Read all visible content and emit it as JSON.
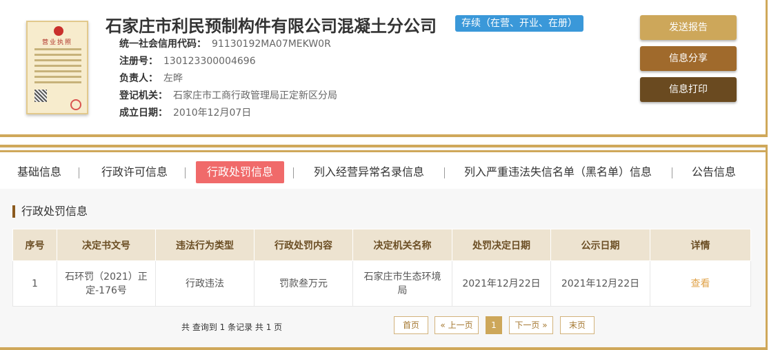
{
  "company": {
    "name": "石家庄市利民预制构件有限公司混凝土分公司",
    "status": "存续（在营、开业、在册）",
    "license_title": "营业执照"
  },
  "info": {
    "credit_code_label": "统一社会信用代码：",
    "credit_code": "91130192MA07MEKW0R",
    "reg_no_label": "注册号：",
    "reg_no": "130123300004696",
    "principal_label": "负责人：",
    "principal": "左晔",
    "authority_label": "登记机关：",
    "authority": "石家庄市工商行政管理局正定新区分局",
    "established_label": "成立日期：",
    "established": "2010年12月07日"
  },
  "actions": {
    "send_report": "发送报告",
    "share": "信息分享",
    "print": "信息打印"
  },
  "tabs": [
    {
      "label": "基础信息"
    },
    {
      "label": "行政许可信息"
    },
    {
      "label": "行政处罚信息"
    },
    {
      "label": "列入经营异常名录信息"
    },
    {
      "label": "列入严重违法失信名单（黑名单）信息"
    },
    {
      "label": "公告信息"
    }
  ],
  "section_title": "行政处罚信息",
  "table": {
    "headers": [
      "序号",
      "决定书文号",
      "违法行为类型",
      "行政处罚内容",
      "决定机关名称",
      "处罚决定日期",
      "公示日期",
      "详情"
    ],
    "rows": [
      {
        "no": "1",
        "doc_no": "石环罚（2021）正定-176号",
        "violation": "行政违法",
        "penalty": "罚款叁万元",
        "authority": "石家庄市生态环境局",
        "decision_date": "2021年12月22日",
        "publish_date": "2021年12月22日",
        "detail": "查看"
      }
    ]
  },
  "pagination": {
    "summary": "共 查询到 1 条记录 共 1 页",
    "first": "首页",
    "prev": "« 上一页",
    "current": "1",
    "next": "下一页 »",
    "last": "末页"
  },
  "colors": {
    "accent_gold": "#cfa85a",
    "status_blue": "#3a98d9",
    "active_tab_red": "#f06a6a"
  }
}
